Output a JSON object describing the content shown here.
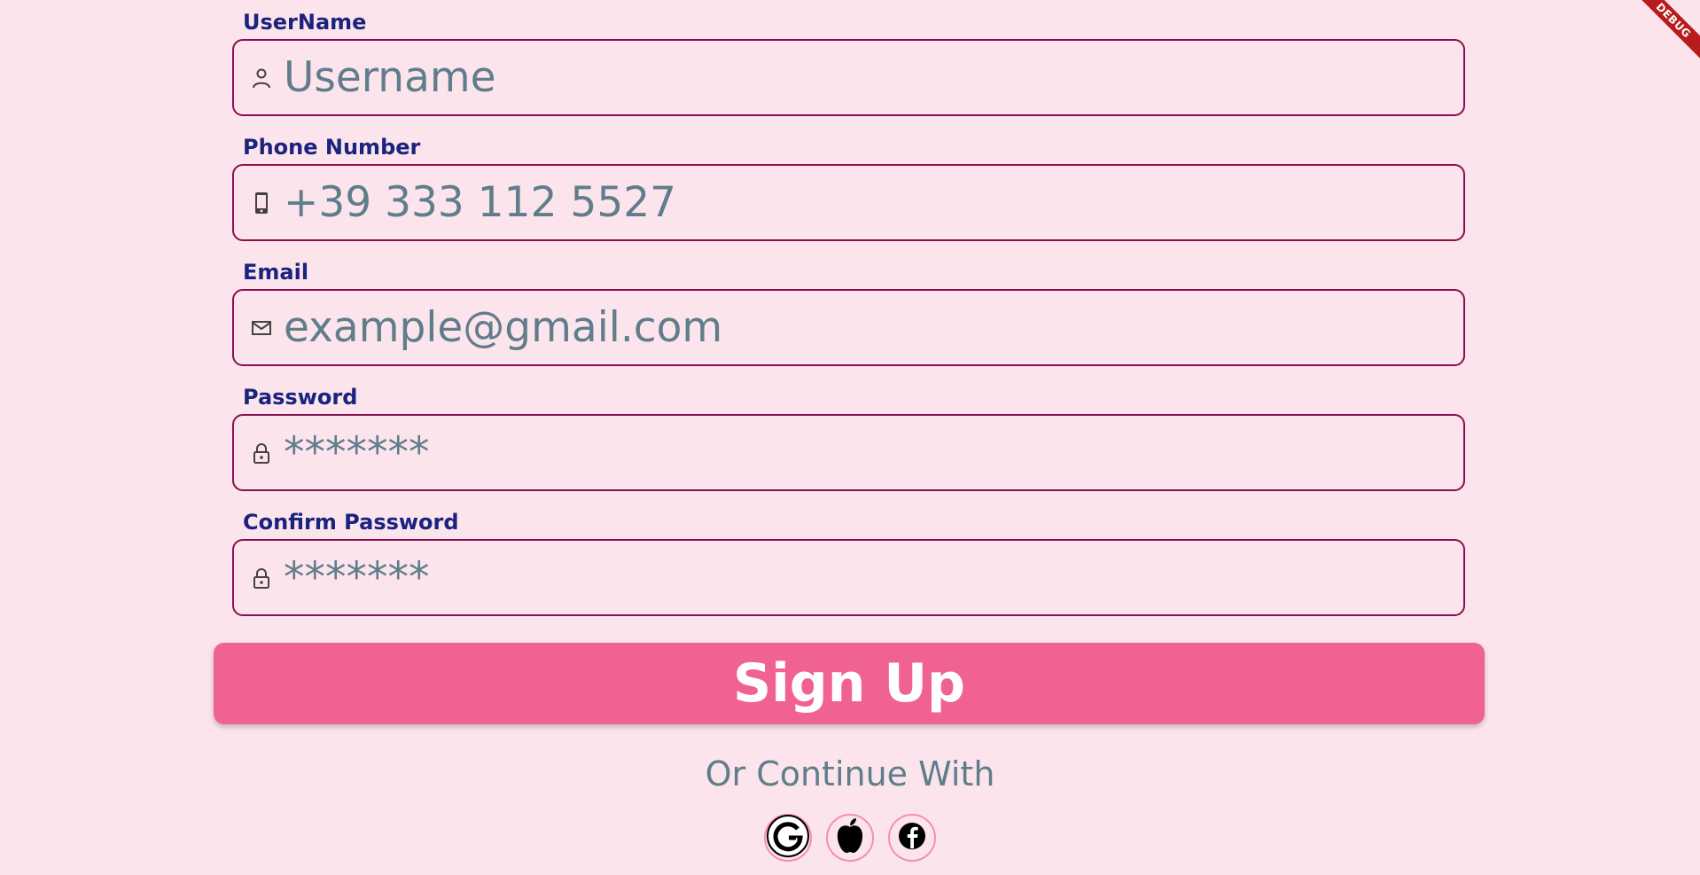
{
  "form": {
    "username": {
      "label": "UserName",
      "placeholder": "Username",
      "icon": "person-icon"
    },
    "phone": {
      "label": "Phone Number",
      "placeholder": "+39 333 112 5527",
      "icon": "phone-icon"
    },
    "email": {
      "label": "Email",
      "placeholder": "example@gmail.com",
      "icon": "mail-icon"
    },
    "password": {
      "label": "Password",
      "placeholder": "*******",
      "icon": "lock-icon"
    },
    "confirm_password": {
      "label": "Confirm Password",
      "placeholder": "*******",
      "icon": "lock-icon"
    }
  },
  "signup_button": {
    "label": "Sign Up"
  },
  "continue_text": "Or Continue With",
  "social": [
    {
      "name": "google",
      "icon": "google-icon"
    },
    {
      "name": "apple",
      "icon": "apple-icon"
    },
    {
      "name": "facebook",
      "icon": "facebook-icon"
    }
  ],
  "debug_banner": "DEBUG",
  "colors": {
    "background": "#fce4ec",
    "label": "#1a237e",
    "border": "#880e4f",
    "button": "#f06292",
    "placeholder": "#607d8b"
  }
}
